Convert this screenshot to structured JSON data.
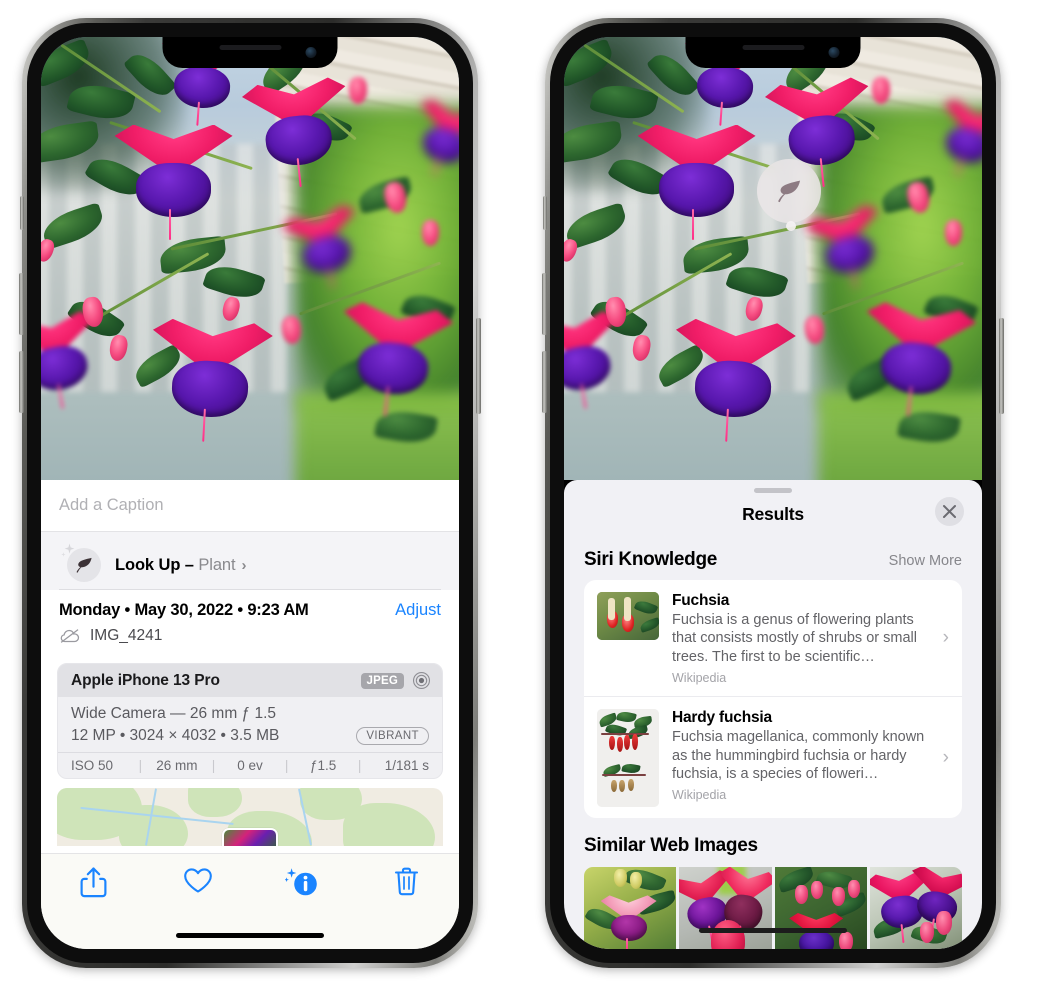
{
  "left_phone": {
    "caption": {
      "placeholder": "Add a Caption",
      "value": ""
    },
    "lookup": {
      "icon": "leaf-icon",
      "label": "Look Up – ",
      "subject": "Plant",
      "chevron": "›"
    },
    "metadata": {
      "date_line": "Monday • May 30, 2022 • 9:23 AM",
      "adjust_label": "Adjust",
      "cloud_icon": "cloud-slash-icon",
      "filename": "IMG_4241"
    },
    "camera_card": {
      "model": "Apple iPhone 13 Pro",
      "format_badge": "JPEG",
      "aperture_icon": "aperture-icon",
      "lens_line": "Wide Camera — 26 mm ƒ 1.5",
      "spec_line": "12 MP • 3024 × 4032 • 3.5 MB",
      "style_badge": "VIBRANT",
      "exif": [
        "ISO 50",
        "26 mm",
        "0 ev",
        "ƒ1.5",
        "1/181 s"
      ]
    },
    "toolbar": [
      {
        "name": "share-button",
        "icon": "share-icon"
      },
      {
        "name": "favorite-button",
        "icon": "heart-icon"
      },
      {
        "name": "info-button",
        "icon": "info-sparkle-icon"
      },
      {
        "name": "delete-button",
        "icon": "trash-icon"
      }
    ],
    "accent_color": "#1a84ff"
  },
  "right_phone": {
    "visual_lookup_badge": {
      "icon": "leaf-icon",
      "label": ""
    },
    "sheet": {
      "title": "Results",
      "close_icon": "close-icon",
      "sections": [
        {
          "title": "Siri Knowledge",
          "action": "Show More",
          "items": [
            {
              "title": "Fuchsia",
              "description": "Fuchsia is a genus of flowering plants that consists mostly of shrubs or small trees. The first to be scientific…",
              "source": "Wikipedia",
              "chevron": "›"
            },
            {
              "title": "Hardy fuchsia",
              "description": "Fuchsia magellanica, commonly known as the hummingbird fuchsia or hardy fuchsia, is a species of floweri…",
              "source": "Wikipedia",
              "chevron": "›"
            }
          ]
        },
        {
          "title": "Similar Web Images",
          "images": [
            "web-image-1",
            "web-image-2",
            "web-image-3",
            "web-image-4"
          ]
        }
      ]
    }
  },
  "colors": {
    "accent": "#1a84ff",
    "sheet_bg": "#f1f1f5",
    "card_bg": "#ffffff",
    "secondary_text": "#8a8a8e"
  }
}
